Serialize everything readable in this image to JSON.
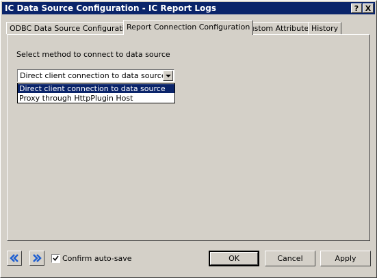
{
  "window": {
    "title": "IC Data Source Configuration - IC Report Logs",
    "help_glyph": "?",
    "close_glyph": "X"
  },
  "tabs": [
    {
      "label": "ODBC Data Source Configuration"
    },
    {
      "label": "Report Connection Configuration"
    },
    {
      "label": "Custom Attributes"
    },
    {
      "label": "History"
    }
  ],
  "connection": {
    "prompt": "Select method to connect to data source",
    "selected": "Direct client connection to data source",
    "options": [
      "Direct client connection to data source",
      "Proxy through HttpPlugin Host"
    ]
  },
  "footer": {
    "confirm_autosave_label": "Confirm auto-save",
    "confirm_autosave_checked": true,
    "ok_label": "OK",
    "cancel_label": "Cancel",
    "apply_label": "Apply"
  },
  "colors": {
    "titlebar": "#0a246a",
    "face": "#d4d0c8",
    "selection": "#0a246a",
    "nav_icon": "#1f5fd1"
  }
}
